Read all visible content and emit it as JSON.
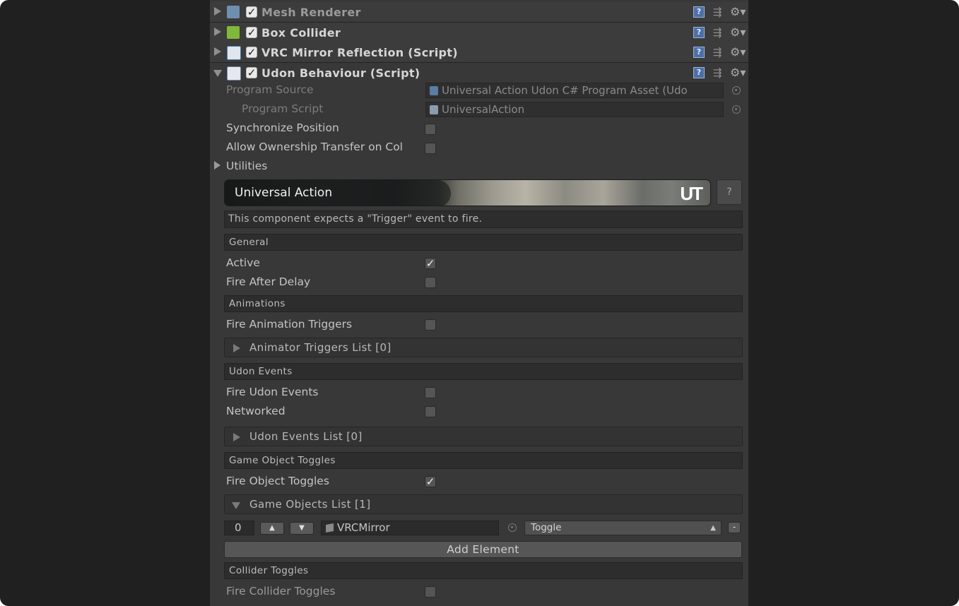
{
  "components": [
    {
      "title": "Mesh Renderer"
    },
    {
      "title": "Box Collider"
    },
    {
      "title": "VRC Mirror Reflection (Script)"
    },
    {
      "title": "Udon Behaviour (Script)"
    }
  ],
  "udon": {
    "program_source_label": "Program Source",
    "program_source_value": "Universal Action Udon C# Program Asset (Udo",
    "program_script_label": "Program Script",
    "program_script_value": "UniversalAction",
    "sync_position_label": "Synchronize Position",
    "ownership_label": "Allow Ownership Transfer on Col",
    "utilities_label": "Utilities"
  },
  "banner": {
    "title": "Universal Action",
    "logo": "UT",
    "help_label": "?"
  },
  "info": "This component expects a \"Trigger\" event to fire.",
  "general": {
    "header": "General",
    "active_label": "Active",
    "fire_after_delay_label": "Fire After Delay"
  },
  "animations": {
    "header": "Animations",
    "fire_triggers_label": "Fire Animation Triggers",
    "list_label": "Animator Triggers List [0]"
  },
  "udon_events": {
    "header": "Udon Events",
    "fire_events_label": "Fire Udon Events",
    "networked_label": "Networked",
    "list_label": "Udon Events List [0]"
  },
  "game_object_toggles": {
    "header": "Game Object Toggles",
    "fire_label": "Fire Object Toggles",
    "list_label": "Game Objects List [1]",
    "element": {
      "index": "0",
      "object": "VRCMirror",
      "mode": "Toggle"
    },
    "add_label": "Add Element"
  },
  "collider_toggles": {
    "header": "Collider Toggles",
    "fire_label": "Fire Collider Toggles"
  },
  "icons": {
    "help": "?",
    "preset": "⇶",
    "gear": "⚙▾",
    "check": "✓"
  }
}
